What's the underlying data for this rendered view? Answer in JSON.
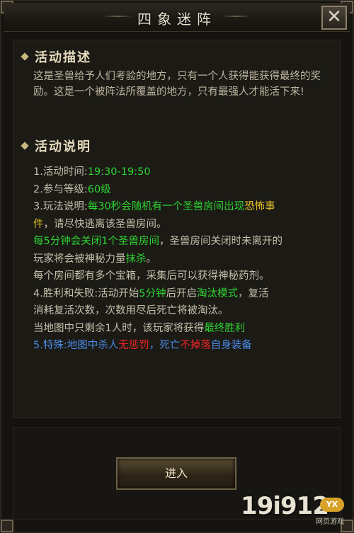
{
  "window": {
    "title": "四象迷阵",
    "close_label": "✕"
  },
  "sections": {
    "description_header": "活动描述",
    "description_text": "这是圣兽给予人们考验的地方，只有一个人获得能获得最终的奖励。这是一个被阵法所覆盖的地方，只有最强人才能活下来!",
    "rules_header": "活动说明"
  },
  "rules": [
    [
      {
        "t": "1.活动时间:",
        "c": "plain"
      },
      {
        "t": "19:30-19:50",
        "c": "green"
      }
    ],
    [
      {
        "t": "2.参与等级:",
        "c": "plain"
      },
      {
        "t": "60级",
        "c": "green"
      }
    ],
    [
      {
        "t": "3.玩法说明:",
        "c": "plain"
      },
      {
        "t": "每30秒会随机有一个圣兽房间出现",
        "c": "green"
      },
      {
        "t": "恐怖事",
        "c": "yellow"
      }
    ],
    [
      {
        "t": "件",
        "c": "yellow"
      },
      {
        "t": "，请尽快逃离该圣兽房间。",
        "c": "plain"
      }
    ],
    [
      {
        "t": "每5分钟会关闭1个圣兽房间",
        "c": "green"
      },
      {
        "t": "，圣兽房间关闭时未离开的",
        "c": "plain"
      }
    ],
    [
      {
        "t": "玩家将会被神秘力量",
        "c": "plain"
      },
      {
        "t": "抹杀",
        "c": "green"
      },
      {
        "t": "。",
        "c": "plain"
      }
    ],
    [
      {
        "t": "每个房间都有多个宝箱，采集后可以获得神秘药剂。",
        "c": "plain"
      }
    ],
    [
      {
        "t": "4.胜利和失败:活动开始",
        "c": "plain"
      },
      {
        "t": "5分钟",
        "c": "green"
      },
      {
        "t": "后开启",
        "c": "plain"
      },
      {
        "t": "淘汰模式",
        "c": "green"
      },
      {
        "t": "，复活",
        "c": "plain"
      }
    ],
    [
      {
        "t": "消耗复活次数，次数用尽后死亡将被淘汰。",
        "c": "plain"
      }
    ],
    [
      {
        "t": "当地图中只剩余1人时，该玩家将获得",
        "c": "plain"
      },
      {
        "t": "最终胜利",
        "c": "green"
      }
    ],
    [
      {
        "t": "5.特殊:地图中杀人",
        "c": "blue"
      },
      {
        "t": "无惩罚",
        "c": "red"
      },
      {
        "t": "，死亡",
        "c": "blue"
      },
      {
        "t": "不掉落",
        "c": "red"
      },
      {
        "t": "自身装备",
        "c": "blue"
      }
    ]
  ],
  "buttons": {
    "enter_label": "进入"
  },
  "watermark": {
    "logo_text": "19i912",
    "badge": "YX",
    "sub": "网页游戏"
  }
}
